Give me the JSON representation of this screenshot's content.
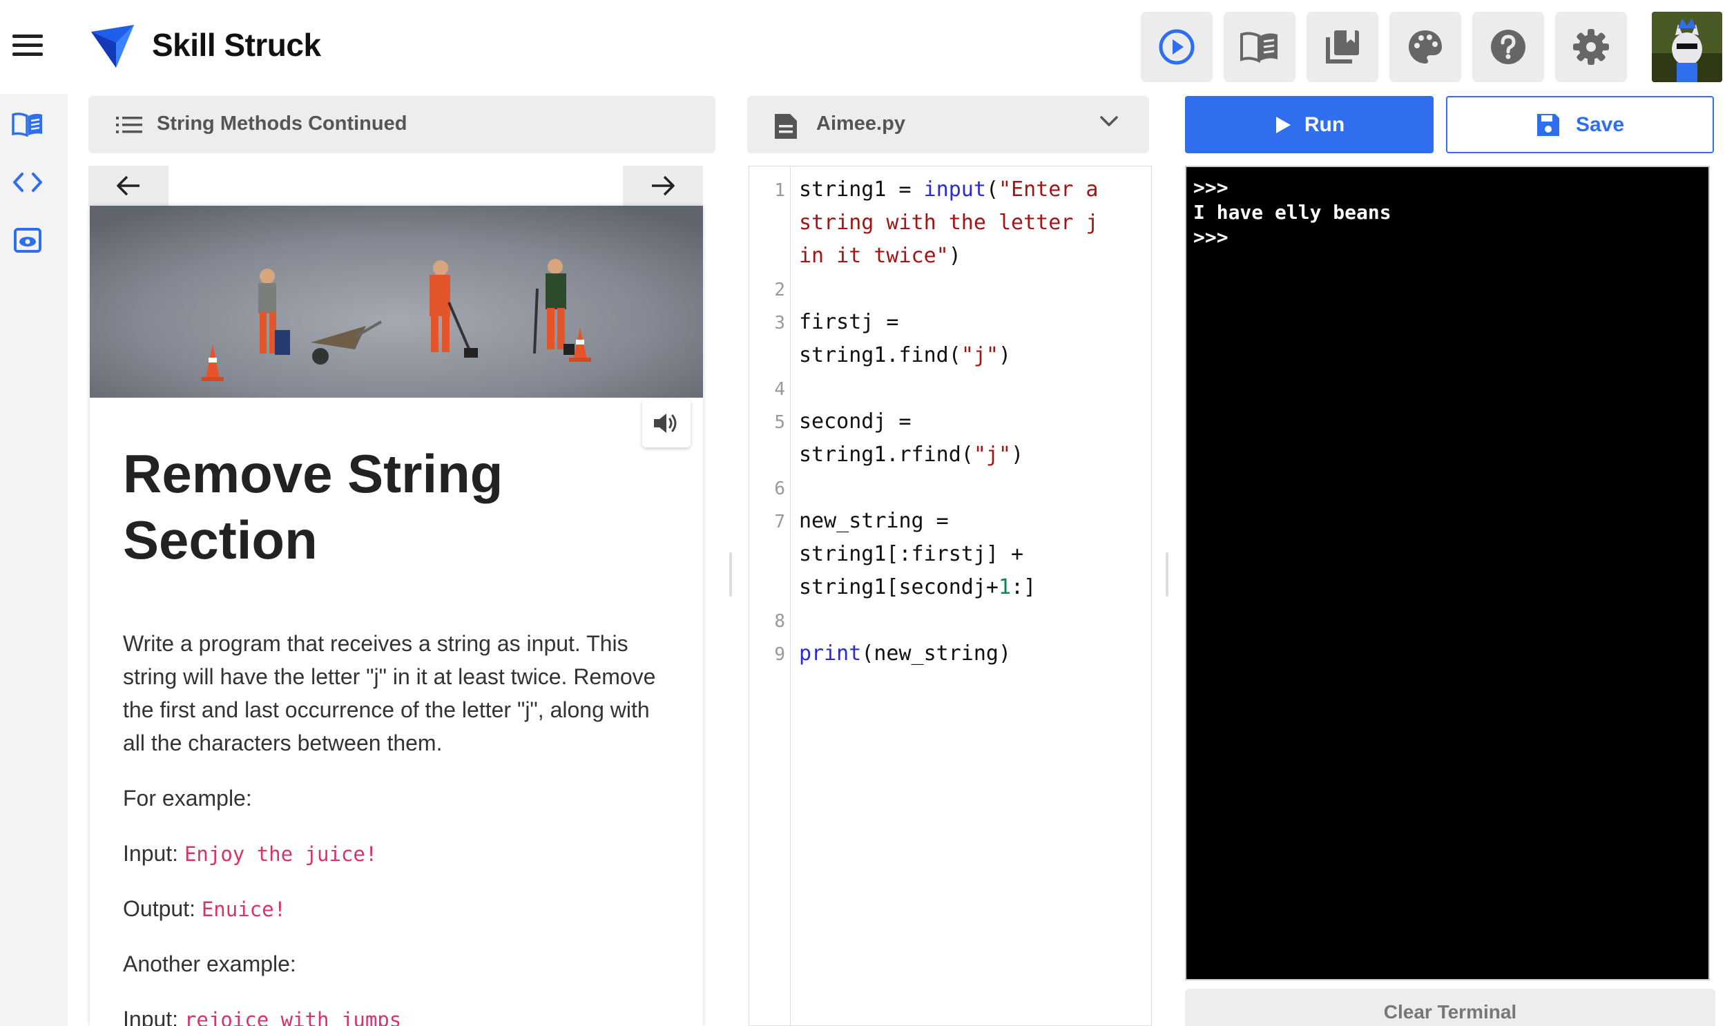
{
  "header": {
    "brand": "Skill Struck",
    "buttons": [
      {
        "name": "play-circle-icon"
      },
      {
        "name": "open-book-icon"
      },
      {
        "name": "library-icon"
      },
      {
        "name": "palette-icon"
      },
      {
        "name": "help-icon"
      },
      {
        "name": "settings-icon"
      }
    ]
  },
  "rail": {
    "items": [
      {
        "name": "lesson-book-icon"
      },
      {
        "name": "code-brackets-icon"
      },
      {
        "name": "preview-eye-icon"
      }
    ]
  },
  "lesson": {
    "title": "String Methods Continued",
    "heading": "Remove String Section",
    "paragraph1": "Write a program that receives a string as input. This string will have the letter \"j\" in it at least twice. Remove the first and last occurrence of the letter \"j\", along with all the characters between them.",
    "for_example": "For example:",
    "input_label": "Input:",
    "input_value": "Enjoy the juice!",
    "output_label": "Output:",
    "output_value": "Enuice!",
    "another_example": "Another example:",
    "input2_label": "Input:",
    "input2_value": "rejoice with jumps"
  },
  "editor": {
    "file_name": "Aimee.py",
    "line_numbers": [
      "1",
      "2",
      "3",
      "4",
      "5",
      "6",
      "7",
      "8",
      "9"
    ]
  },
  "controls": {
    "run_label": "Run",
    "save_label": "Save",
    "clear_label": "Clear Terminal"
  },
  "terminal": {
    "lines": [
      ">>>",
      "I have elly beans",
      ">>>"
    ]
  },
  "colors": {
    "accent": "#2f6fef",
    "inline_code": "#d6336c",
    "keyword": "#2b2bd6",
    "string": "#a31515"
  }
}
